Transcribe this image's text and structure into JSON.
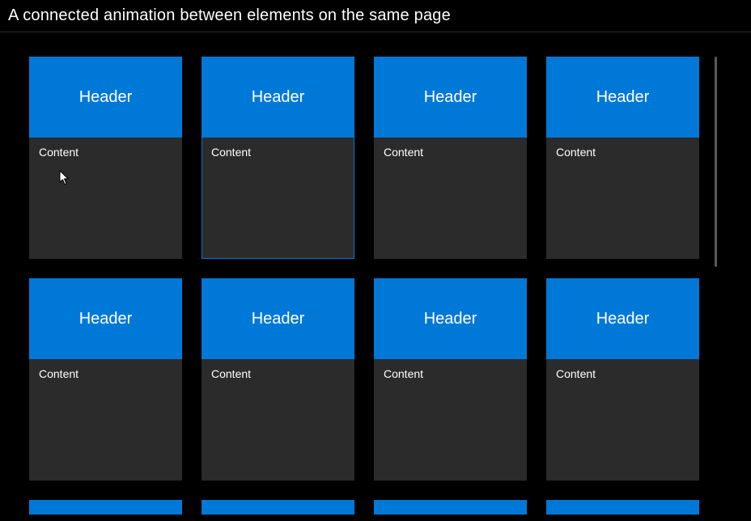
{
  "title": "A connected animation between elements on the same page",
  "card_header_label": "Header",
  "card_content_label": "Content",
  "selected_index": 1,
  "colors": {
    "accent": "#0078d7",
    "card_bg": "#2b2b2b",
    "page_bg": "#000000"
  },
  "grid": {
    "rows_visible": 2,
    "columns": 4,
    "partial_row_visible": true
  }
}
